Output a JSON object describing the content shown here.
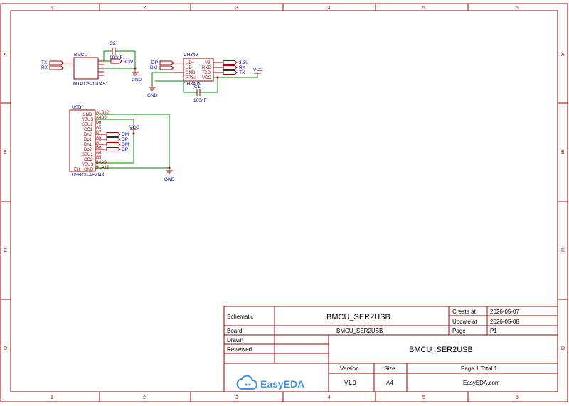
{
  "border": {
    "columns": [
      "1",
      "2",
      "3",
      "4",
      "5",
      "6"
    ],
    "rows": [
      "A",
      "B",
      "C",
      "D"
    ]
  },
  "parts": {
    "bmcu": {
      "ref": "BMCU",
      "value": "MTP125-1204S1"
    },
    "c2": {
      "ref": "C2",
      "value": "100nF"
    },
    "ch340": {
      "ref": "CH340",
      "value": "CH340N",
      "pins_left": [
        "UD+",
        "UD-",
        "GND",
        "RTS#"
      ],
      "pins_right": [
        "V3",
        "RXD",
        "TXD",
        "VCC"
      ]
    },
    "c1": {
      "ref": "C1",
      "value": "100nF"
    },
    "usb": {
      "ref": "USB",
      "value": "USBC1-AF-048",
      "pins": [
        "GND",
        "VBUS",
        "SBU2",
        "CC1",
        "Dn2",
        "Dp1",
        "Dn1",
        "Dp2",
        "SBU1",
        "CC2",
        "VBUS",
        "GND"
      ],
      "pin_numbers": [
        "A1B12",
        "A4B9",
        "B8",
        "A5",
        "B7",
        "A6",
        "A7",
        "B6",
        "A8",
        "B5",
        "B4A9",
        "B1A12"
      ],
      "eh": "EH"
    }
  },
  "nets": {
    "tx": "TX",
    "rx": "RX",
    "v33": "3.3V",
    "gnd": "GND",
    "vcc": "VCC",
    "dp": "DP",
    "dm": "DM"
  },
  "title_block": {
    "schematic_label": "Schematic",
    "schematic_value": "BMCU_SER2USB",
    "create_label": "Create at",
    "create_value": "2026-05-07",
    "update_label": "Update at",
    "update_value": "2026-05-08",
    "board_label": "Board",
    "board_value": "BMCU_SER2USB",
    "page_label": "Page",
    "page_value": "P1",
    "drawn_label": "Drawn",
    "reviewed_label": "Reviewed",
    "big_title": "BMCU_SER2USB",
    "version_label": "Version",
    "size_label": "Size",
    "page_total": "Page  1  Total  1",
    "version_value": "V1.0",
    "size_value": "A4",
    "site": "EasyEDA.com",
    "logo_text": "EasyEDA"
  }
}
